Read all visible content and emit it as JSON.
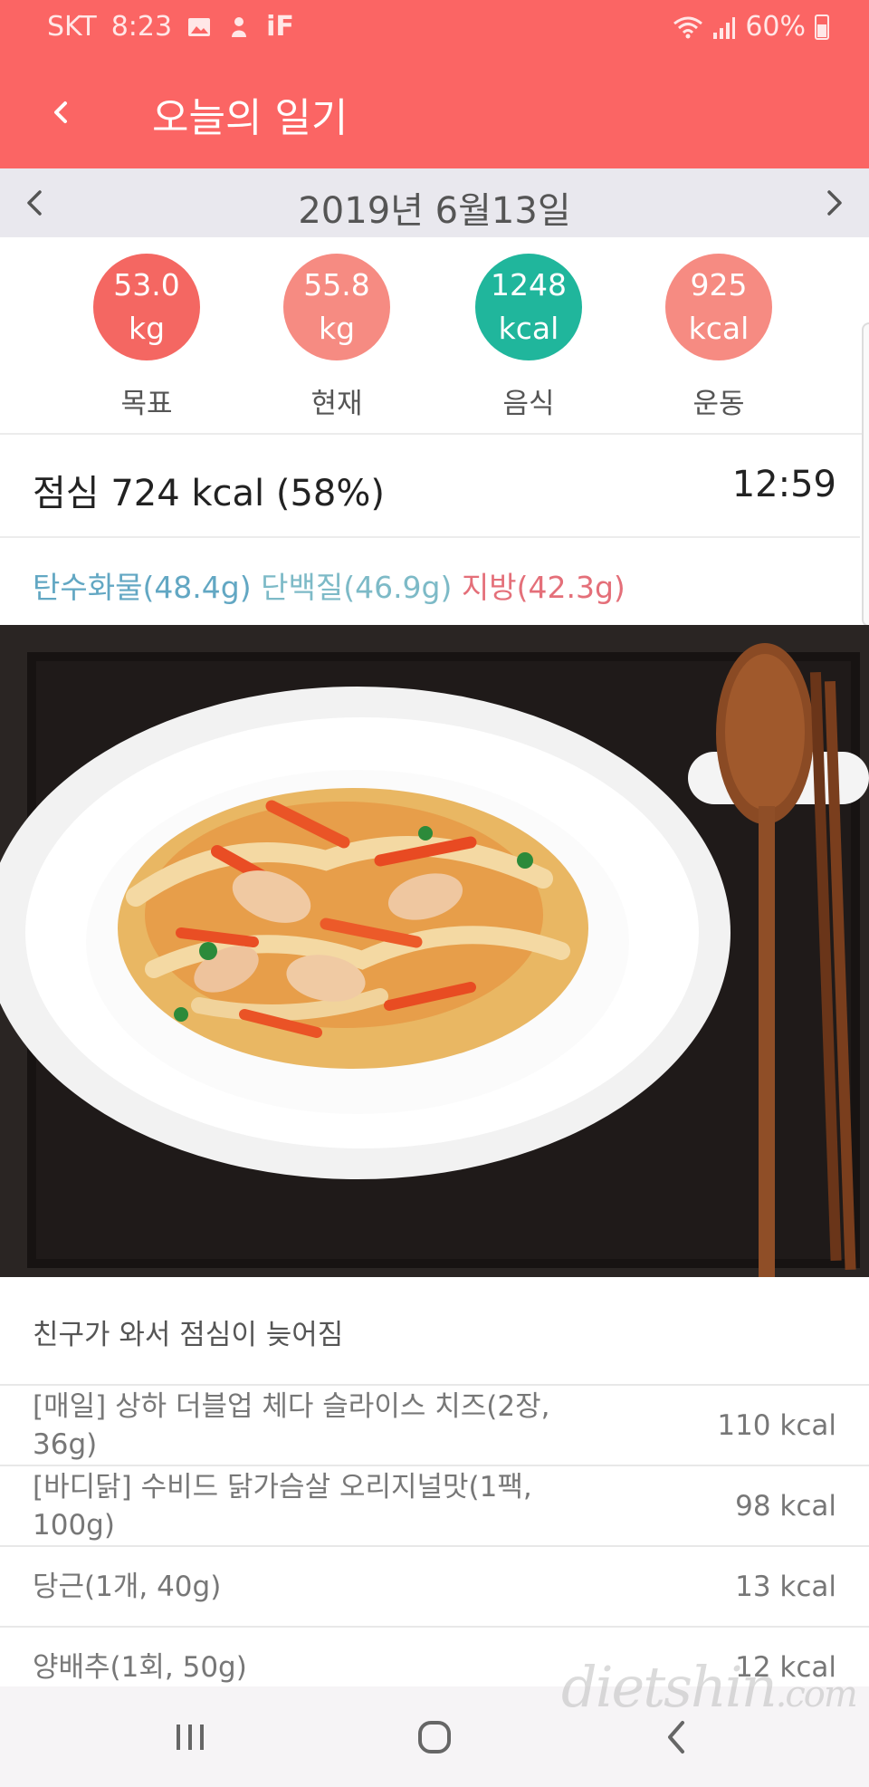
{
  "status_bar": {
    "carrier": "SKT",
    "time": "8:23",
    "app_text": "iF",
    "battery": "60%"
  },
  "header": {
    "title": "오늘의 일기"
  },
  "date_nav": {
    "date": "2019년 6월13일"
  },
  "stats": [
    {
      "value": "53.0",
      "unit": "kg",
      "label": "목표",
      "color": "#f46762"
    },
    {
      "value": "55.8",
      "unit": "kg",
      "label": "현재",
      "color": "#f68b82"
    },
    {
      "value": "1248",
      "unit": "kcal",
      "label": "음식",
      "color": "#20b69c"
    },
    {
      "value": "925",
      "unit": "kcal",
      "label": "운동",
      "color": "#f68b82"
    }
  ],
  "meal": {
    "title": "점심 724 kcal (58%)",
    "time": "12:59"
  },
  "macros": {
    "carb": "탄수화물(48.4g)",
    "protein": "단백질(46.9g)",
    "fat": "지방(42.3g)"
  },
  "memo": "친구가 와서 점심이 늦어짐",
  "foods": [
    {
      "name": "[매일] 상하 더블업 체다 슬라이스 치즈(2장, 36g)",
      "kcal": "110 kcal"
    },
    {
      "name": "[바디닭] 수비드 닭가슴살 오리지널맛(1팩, 100g)",
      "kcal": "98 kcal"
    },
    {
      "name": "당근(1개, 40g)",
      "kcal": "13 kcal"
    },
    {
      "name": "양배추(1회, 50g)",
      "kcal": "12 kcal"
    }
  ],
  "watermark": {
    "main": "dietshin",
    "suffix": ".com"
  },
  "colors": {
    "header": "#fb6564",
    "date_bar": "#e9e8ee",
    "carb": "#62a7c3",
    "protein": "#7dbac7",
    "fat": "#e46f79"
  },
  "icons": [
    "back-arrow-icon",
    "chevron-left-icon",
    "chevron-right-icon",
    "wifi-icon",
    "signal-icon",
    "battery-icon",
    "recents-icon",
    "home-icon",
    "nav-back-icon"
  ]
}
